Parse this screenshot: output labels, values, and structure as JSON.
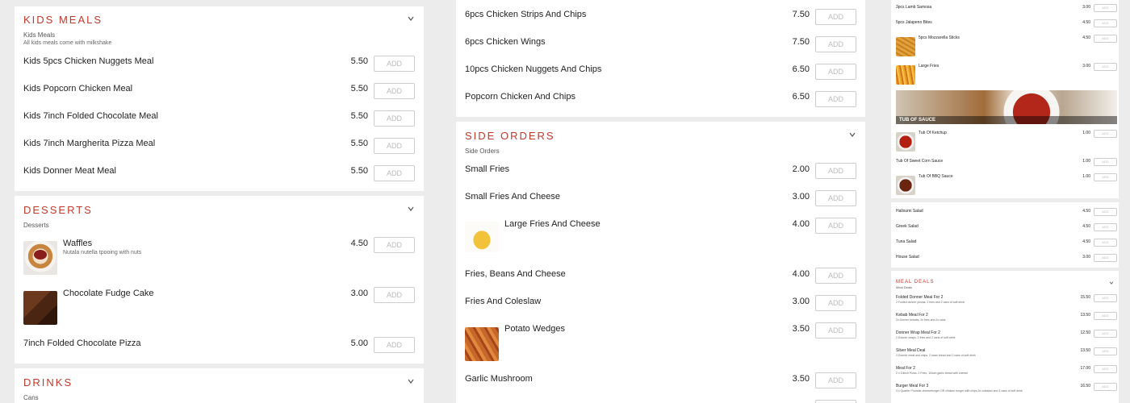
{
  "add_label": "ADD",
  "col1": {
    "kids": {
      "title": "KIDS MEALS",
      "subtitle": "Kids Meals",
      "desc": "All kids meals come with milkshake",
      "items": [
        {
          "name": "Kids 5pcs Chicken Nuggets Meal",
          "price": "5.50"
        },
        {
          "name": "Kids Popcorn Chicken Meal",
          "price": "5.50"
        },
        {
          "name": "Kids 7inch Folded Chocolate Meal",
          "price": "5.50"
        },
        {
          "name": "Kids 7inch Margherita Pizza Meal",
          "price": "5.50"
        },
        {
          "name": "Kids Donner Meat Meal",
          "price": "5.50"
        }
      ]
    },
    "desserts": {
      "title": "DESSERTS",
      "subtitle": "Desserts",
      "items": [
        {
          "name": "Waffles",
          "desc": "Nutala nutella tpooing with nuts",
          "price": "4.50"
        },
        {
          "name": "Chocolate Fudge Cake",
          "price": "3.00"
        },
        {
          "name": "7inch Folded Chocolate Pizza",
          "price": "5.00"
        }
      ]
    },
    "drinks": {
      "title": "DRINKS",
      "subtitle": "Cans"
    }
  },
  "col2": {
    "top_items": [
      {
        "name": "6pcs Chicken Strips And Chips",
        "price": "7.50"
      },
      {
        "name": "6pcs Chicken Wings",
        "price": "7.50"
      },
      {
        "name": "10pcs Chicken Nuggets And Chips",
        "price": "6.50"
      },
      {
        "name": "Popcorn Chicken And Chips",
        "price": "6.50"
      }
    ],
    "side": {
      "title": "SIDE ORDERS",
      "subtitle": "Side Orders",
      "items": [
        {
          "name": "Small Fries",
          "price": "2.00"
        },
        {
          "name": "Small Fries And Cheese",
          "price": "3.00"
        },
        {
          "name": "Large Fries And Cheese",
          "price": "4.00"
        },
        {
          "name": "Fries, Beans And Cheese",
          "price": "4.00"
        },
        {
          "name": "Fries And Coleslaw",
          "price": "3.00"
        },
        {
          "name": "Potato Wedges",
          "price": "3.50"
        },
        {
          "name": "Garlic Mushroom",
          "price": "3.50"
        }
      ]
    }
  },
  "col3": {
    "top": [
      {
        "name": "3pcs Lamb Samosa",
        "price": "3.00"
      },
      {
        "name": "5pcs Jalapeno Bites",
        "price": "4.50"
      },
      {
        "name": "5pcs Mozzarella Sticks",
        "price": "4.50"
      },
      {
        "name": "Large Fries",
        "price": "3.00"
      }
    ],
    "banner": "TUB OF SAUCE",
    "sauces": [
      {
        "name": "Tub Of Ketchup",
        "price": "1.00"
      },
      {
        "name": "Tub Of Sweet Corn Sauce",
        "price": "1.00"
      },
      {
        "name": "Tub Of BBQ Sauce",
        "price": "1.00"
      }
    ],
    "salads": [
      {
        "name": "Halloumi Salad",
        "price": "4.50"
      },
      {
        "name": "Greek Salad",
        "price": "4.50"
      },
      {
        "name": "Tuna Salad",
        "price": "4.50"
      },
      {
        "name": "House Salad",
        "price": "3.00"
      }
    ],
    "deals": {
      "title": "MEAL DEALS",
      "subtitle": "Meal Deals",
      "items": [
        {
          "name": "Folded Donner Meal For 2",
          "desc": "2 Folded donner pizzas, 2 fries and 2 cans of soft drink",
          "price": "15.50"
        },
        {
          "name": "Kebab Meal For 2",
          "desc": "2x Donner kebabs, 2x fries and 2x cans",
          "price": "13.50"
        },
        {
          "name": "Donner Wrap Meal For 2",
          "desc": "2 Donner wraps, 2 fries and 2 cans of soft drink",
          "price": "12.50"
        },
        {
          "name": "Silver Meal Deal",
          "desc": "2 Donner meat and chips, 2 naan bread and 2 cans of soft drink",
          "price": "13.50"
        },
        {
          "name": "Meal For 2",
          "desc": "2 x 10inch Pizza, 2 Fries, 10inch garlic bread with cheese",
          "price": "17.00"
        },
        {
          "name": "Burger Meal For 3",
          "desc": "3 x Quarter Pounder cheeseburger OR chicken burger with chips,3x coleslaw and 3 cans of soft drink",
          "price": "16.50"
        }
      ]
    }
  }
}
